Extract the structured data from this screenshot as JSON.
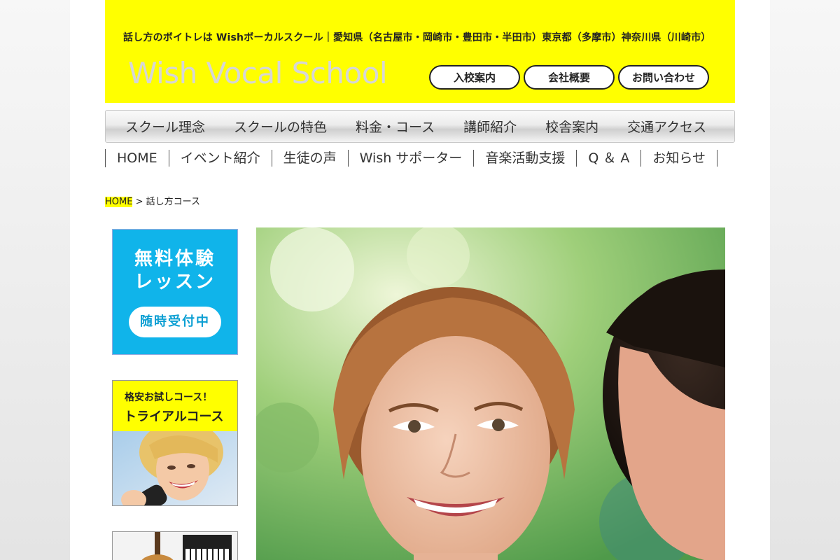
{
  "header": {
    "tagline": "話し方のボイトレは Wishボーカルスクール｜愛知県（名古屋市・岡崎市・豊田市・半田市）東京都（多摩市）神奈川県（川崎市）",
    "logo": "Wish Vocal School",
    "buttons": [
      "入校案内",
      "会社概要",
      "お問い合わせ"
    ]
  },
  "main_nav": [
    "スクール理念",
    "スクールの特色",
    "料金・コース",
    "講師紹介",
    "校舎案内",
    "交通アクセス"
  ],
  "sub_nav": [
    "HOME",
    "イベント紹介",
    "生徒の声",
    "Wish サポーター",
    "音楽活動支援",
    "Q ＆ A",
    "お知らせ"
  ],
  "breadcrumb": {
    "home": "HOME",
    "separator": " > ",
    "current": "話し方コース"
  },
  "banners": {
    "free_trial": {
      "line1": "無料体験",
      "line2": "レッスン",
      "pill": "随時受付中"
    },
    "trial_course": {
      "line1": "格安お試しコース！",
      "line2": "トライアルコース"
    }
  },
  "colors": {
    "accent_yellow": "#ffff00",
    "banner_blue": "#10b4ea"
  }
}
